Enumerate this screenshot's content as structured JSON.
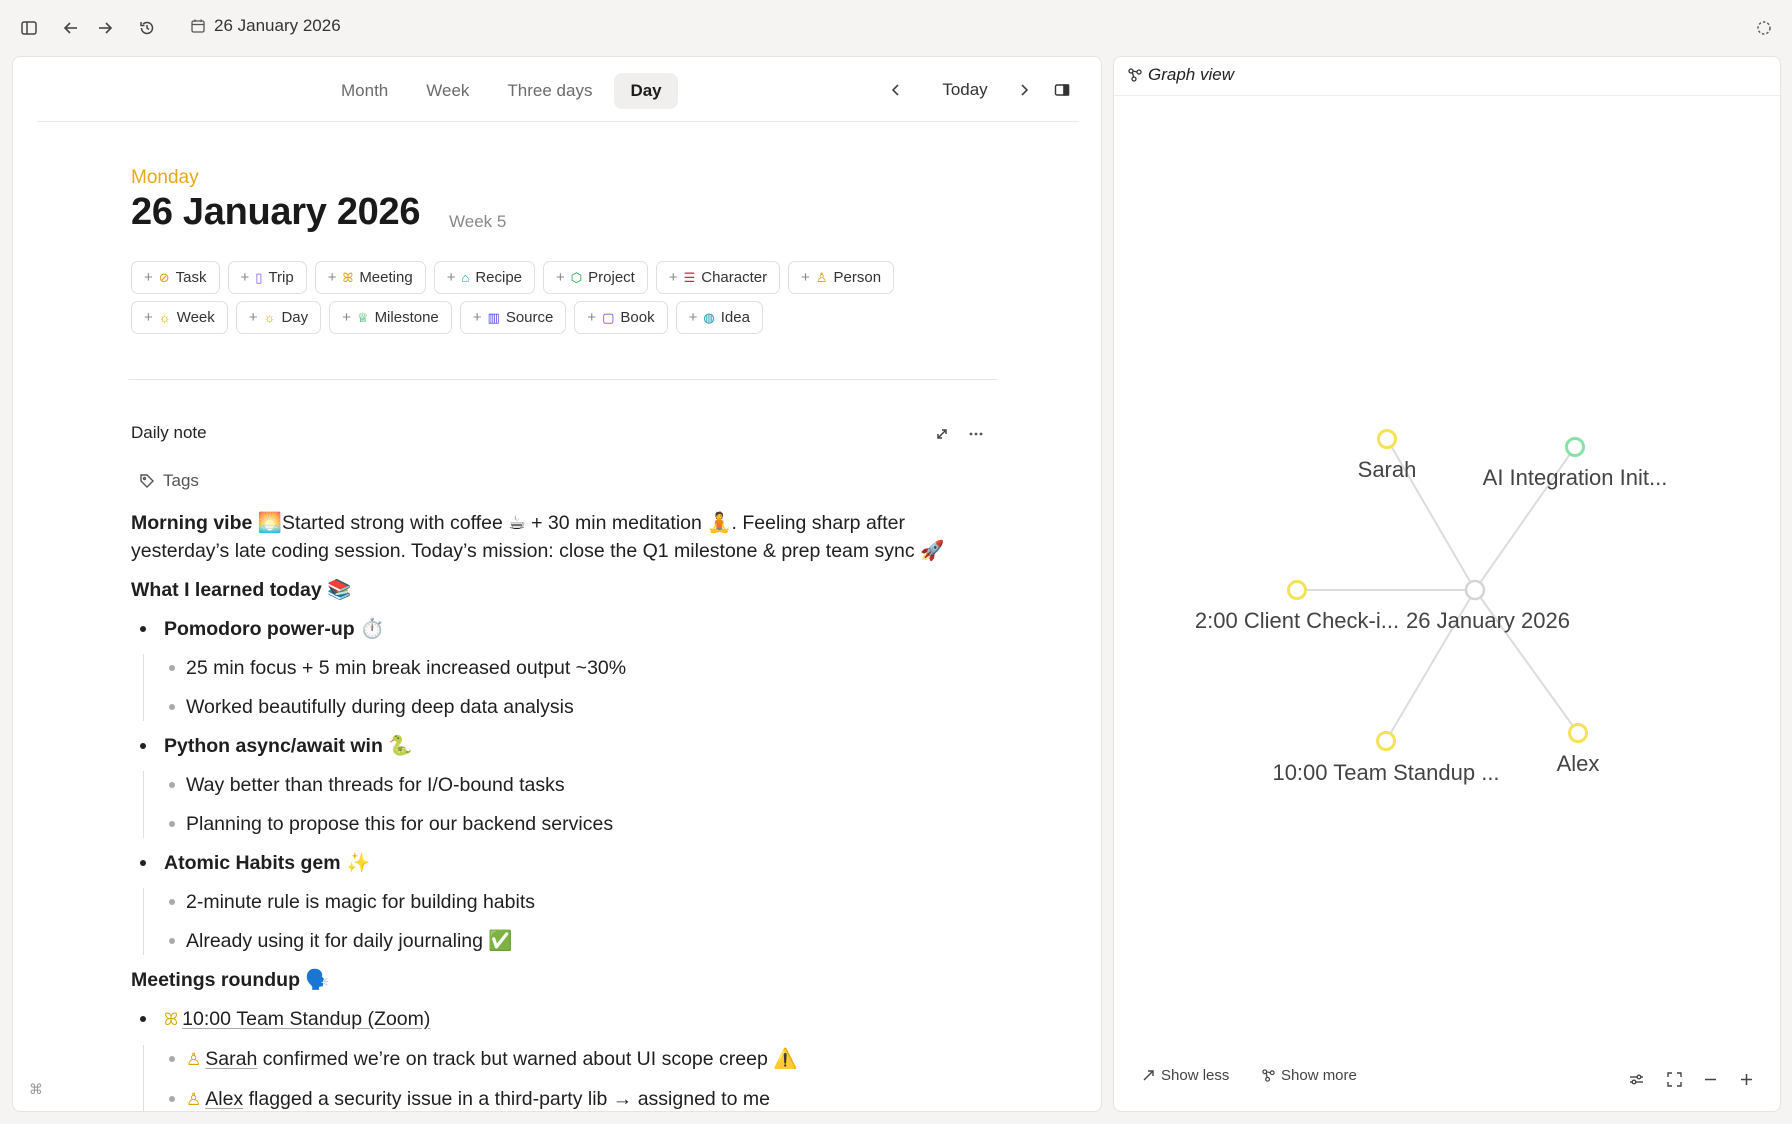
{
  "topbar": {
    "date_label": "26 January 2026",
    "icons": [
      "sidebar-toggle-icon",
      "back-arrow-icon",
      "forward-arrow-icon",
      "history-icon",
      "calendar-icon",
      "sync-icon"
    ]
  },
  "calendar": {
    "views": [
      "Month",
      "Week",
      "Three days",
      "Day"
    ],
    "active_view": "Day",
    "today_label": "Today"
  },
  "day": {
    "weekday": "Monday",
    "title": "26 January 2026",
    "week": "Week 5"
  },
  "quick_add": {
    "row1": [
      {
        "label": "Task",
        "icon": "⊘",
        "color": "#e09b17"
      },
      {
        "label": "Trip",
        "icon": "▯",
        "color": "#8b5cf6"
      },
      {
        "label": "Meeting",
        "icon": "ꕤ",
        "color": "#d9a400"
      },
      {
        "label": "Recipe",
        "icon": "⌂",
        "color": "#0ea5a4"
      },
      {
        "label": "Project",
        "icon": "⬡",
        "color": "#16a34a"
      },
      {
        "label": "Character",
        "icon": "☰",
        "color": "#e11d48"
      },
      {
        "label": "Person",
        "icon": "♙",
        "color": "#d9a400"
      }
    ],
    "row2": [
      {
        "label": "Week",
        "icon": "☼",
        "color": "#e0a800"
      },
      {
        "label": "Day",
        "icon": "☼",
        "color": "#e0a800"
      },
      {
        "label": "Milestone",
        "icon": "♕",
        "color": "#16a34a"
      },
      {
        "label": "Source",
        "icon": "▥",
        "color": "#4f46e5"
      },
      {
        "label": "Book",
        "icon": "▢",
        "color": "#7c3aed"
      },
      {
        "label": "Idea",
        "icon": "◍",
        "color": "#0891b2"
      }
    ]
  },
  "note": {
    "title": "Daily note",
    "tags_label": "Tags",
    "intro_bold": "Morning vibe",
    "intro_text": " 🌅Started strong with coffee ☕ + 30 min meditation 🧘. Feeling sharp after yesterday’s late coding session. Today’s mission: close the Q1 milestone & prep team sync 🚀",
    "learned_heading": "What I learned today 📚",
    "learned": [
      {
        "title": "Pomodoro power-up ⏱️",
        "items": [
          "25 min focus + 5 min break increased output ~30%",
          "Worked beautifully during deep data analysis"
        ]
      },
      {
        "title": "Python async/await win 🐍",
        "items": [
          "Way better than threads for I/O-bound tasks",
          "Planning to propose this for our backend services"
        ]
      },
      {
        "title": "Atomic Habits gem ✨",
        "items": [
          "2-minute rule is magic for building habits",
          "Already using it for daily journaling ✅"
        ]
      }
    ],
    "meetings_heading": "Meetings roundup 🗣️",
    "meeting_link": "10:00 Team Standup (Zoom)",
    "meeting_items": [
      {
        "person": "Sarah",
        "text": " confirmed we’re on track but warned about UI scope creep ⚠️"
      },
      {
        "person": "Alex",
        "text": " flagged a security issue in a third-party lib → assigned to me"
      }
    ]
  },
  "graph": {
    "title": "Graph view",
    "center": "26 January 2026",
    "nodes": [
      {
        "label": "Sarah",
        "color": "#f3e25a"
      },
      {
        "label": "AI Integration Init...",
        "color": "#86e3a8"
      },
      {
        "label": "2:00 Client Check-i...",
        "color": "#f3e25a"
      },
      {
        "label": "10:00 Team Standup ...",
        "color": "#f3e25a"
      },
      {
        "label": "Alex",
        "color": "#f3e25a"
      }
    ],
    "show_less": "Show less",
    "show_more": "Show more"
  }
}
